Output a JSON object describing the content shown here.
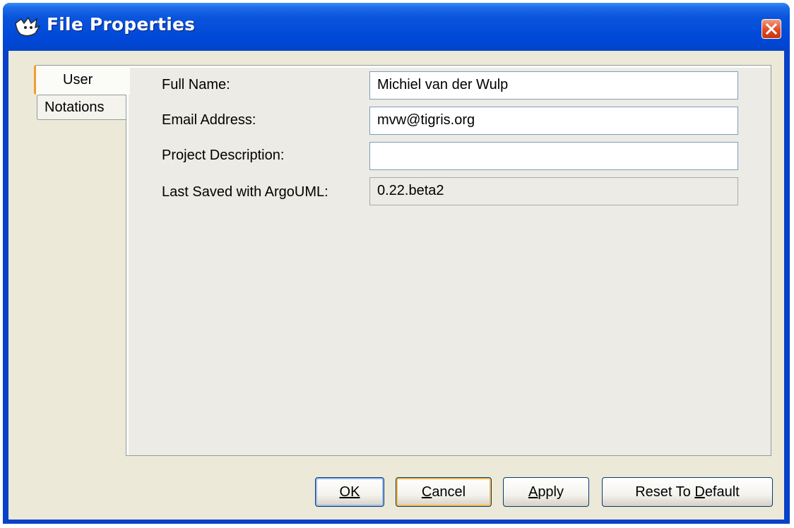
{
  "window": {
    "title": "File Properties",
    "app_icon": "argouml-icon",
    "close_icon": "close-icon"
  },
  "tabs": [
    {
      "label": "User",
      "selected": true
    },
    {
      "label": "Notations",
      "selected": false
    }
  ],
  "form": {
    "full_name": {
      "label": "Full Name:",
      "value": "Michiel van der Wulp"
    },
    "email": {
      "label": "Email Address:",
      "value": "mvw@tigris.org"
    },
    "description": {
      "label": "Project Description:",
      "value": ""
    },
    "last_saved": {
      "label": "Last Saved with ArgoUML:",
      "value": "0.22.beta2"
    }
  },
  "buttons": {
    "ok": {
      "label": "OK",
      "mnemonic": "O"
    },
    "cancel": {
      "label": "Cancel",
      "mnemonic": "C"
    },
    "apply": {
      "label": "Apply",
      "mnemonic": "A"
    },
    "reset": {
      "label": "Reset To Default",
      "mnemonic": "D"
    }
  },
  "colors": {
    "titlebar": "#0a55dc",
    "dialog_bg": "#ece9d8",
    "selected_tab_accent": "#f39d2f",
    "close_button": "#e14a25"
  }
}
